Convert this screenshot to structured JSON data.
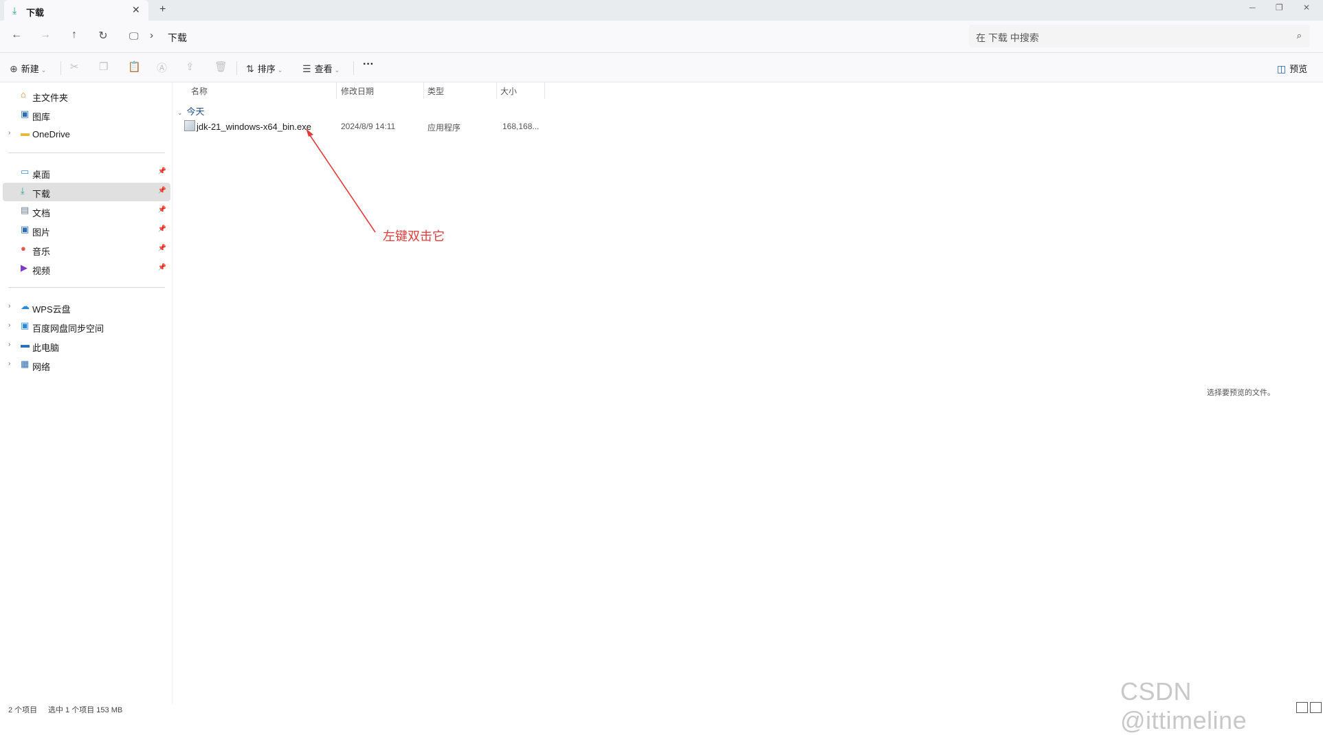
{
  "tab": {
    "title": "下载",
    "icon": "download-icon",
    "close": "✕",
    "new_tab": "+"
  },
  "window_controls": {
    "minimize": "─",
    "restore": "❐",
    "close": "✕"
  },
  "address": {
    "breadcrumb": "下载",
    "search_placeholder": "在 下载 中搜索"
  },
  "toolbar": {
    "new_label": "新建",
    "sort_label": "排序",
    "view_label": "查看",
    "more_label": "···",
    "preview_label": "预览"
  },
  "sidebar": {
    "top_items": [
      {
        "label": "主文件夹",
        "icon": "home-icon"
      },
      {
        "label": "图库",
        "icon": "gallery-icon"
      },
      {
        "label": "OneDrive",
        "icon": "folder-icon"
      }
    ],
    "quick_items": [
      {
        "label": "桌面",
        "icon": "desktop-icon"
      },
      {
        "label": "下载",
        "icon": "download-icon",
        "selected": true
      },
      {
        "label": "文档",
        "icon": "document-icon"
      },
      {
        "label": "图片",
        "icon": "picture-icon"
      },
      {
        "label": "音乐",
        "icon": "music-icon"
      },
      {
        "label": "视频",
        "icon": "video-icon"
      }
    ],
    "bottom_items": [
      {
        "label": "WPS云盘",
        "icon": "cloud-icon"
      },
      {
        "label": "百度网盘同步空间",
        "icon": "sync-icon"
      },
      {
        "label": "此电脑",
        "icon": "computer-icon"
      },
      {
        "label": "网络",
        "icon": "network-icon"
      }
    ]
  },
  "columns": {
    "name": "名称",
    "date": "修改日期",
    "type": "类型",
    "size": "大小"
  },
  "group": {
    "label": "今天"
  },
  "files": [
    {
      "name": "jdk-21_windows-x64_bin.exe",
      "date": "2024/8/9 14:11",
      "type": "应用程序",
      "size": "168,168..."
    }
  ],
  "annotation": {
    "text": "左键双击它",
    "color": "#e03c3c"
  },
  "preview_hint": "选择要预览的文件。",
  "status": {
    "count": "2 个项目",
    "selection": "选中 1 个项目  153 MB"
  },
  "watermark": "CSDN @ittimeline"
}
